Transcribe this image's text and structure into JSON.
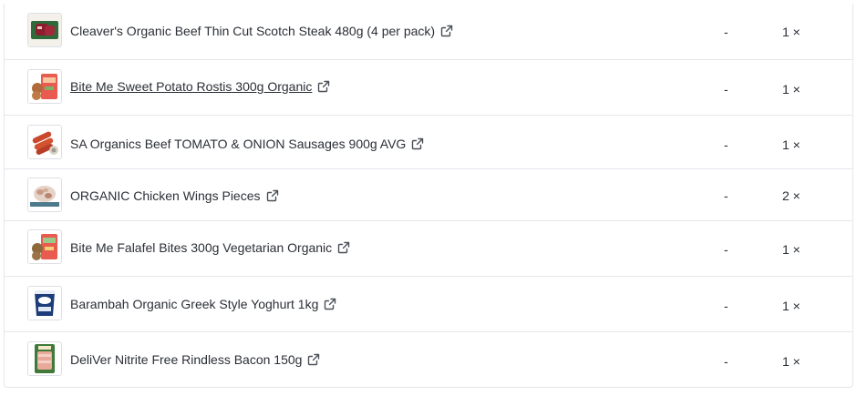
{
  "order_items": [
    {
      "image_icon": "steak-thumbnail",
      "name": "Cleaver's Organic Beef Thin Cut Scotch Steak 480g (4 per pack)",
      "link_icon": "external-link-icon",
      "price": "-",
      "quantity": "1 ×"
    },
    {
      "image_icon": "rostis-thumbnail",
      "name": "Bite Me Sweet Potato Rostis 300g Organic",
      "link_icon": "external-link-icon",
      "price": "-",
      "quantity": "1 ×"
    },
    {
      "image_icon": "sausages-thumbnail",
      "name": "SA Organics Beef TOMATO & ONION Sausages 900g AVG",
      "link_icon": "external-link-icon",
      "price": "-",
      "quantity": "1 ×"
    },
    {
      "image_icon": "chicken-wings-thumbnail",
      "name": "ORGANIC Chicken Wings Pieces",
      "link_icon": "external-link-icon",
      "price": "-",
      "quantity": "2 ×"
    },
    {
      "image_icon": "falafel-thumbnail",
      "name": "Bite Me Falafel Bites 300g Vegetarian Organic",
      "link_icon": "external-link-icon",
      "price": "-",
      "quantity": "1 ×"
    },
    {
      "image_icon": "yoghurt-thumbnail",
      "name": "Barambah Organic Greek Style Yoghurt 1kg",
      "link_icon": "external-link-icon",
      "price": "-",
      "quantity": "1 ×"
    },
    {
      "image_icon": "bacon-thumbnail",
      "name": "DeliVer Nitrite Free Rindless Bacon 150g",
      "link_icon": "external-link-icon",
      "price": "-",
      "quantity": "1 ×"
    }
  ],
  "colors": {
    "text": "#2b2f36",
    "border": "#e4e6ea",
    "background": "#ffffff"
  }
}
